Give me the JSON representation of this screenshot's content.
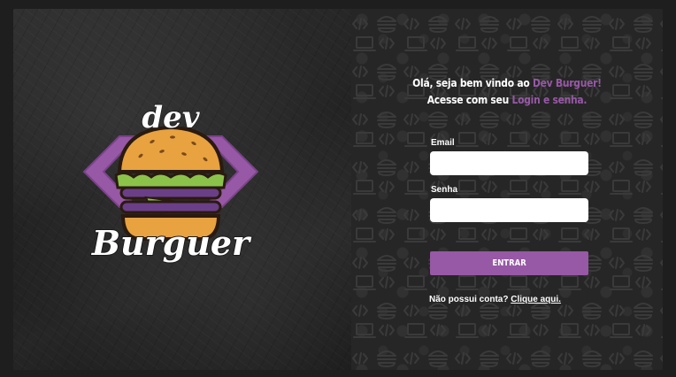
{
  "brand": {
    "logo_top": "dev",
    "logo_bottom": "Burguer"
  },
  "welcome": {
    "line1_prefix": "Olá, seja bem vindo ao ",
    "line1_accent": "Dev Burguer!",
    "line2_prefix": "Acesse com seu ",
    "line2_accent": "Login e senha."
  },
  "form": {
    "email_label": "Email",
    "email_value": "",
    "password_label": "Senha",
    "password_value": "",
    "submit_label": "ENTRAR"
  },
  "signup": {
    "question": "Não possui conta?",
    "link": "Clique aqui."
  },
  "colors": {
    "accent": "#9758a6",
    "background": "#1e1e1e",
    "panel_right": "#262626",
    "bun": "#e8a23f",
    "lettuce": "#8bc34a"
  },
  "icons": [
    "burger-pattern-icon",
    "laptop-pattern-icon",
    "code-tag-pattern-icon"
  ]
}
